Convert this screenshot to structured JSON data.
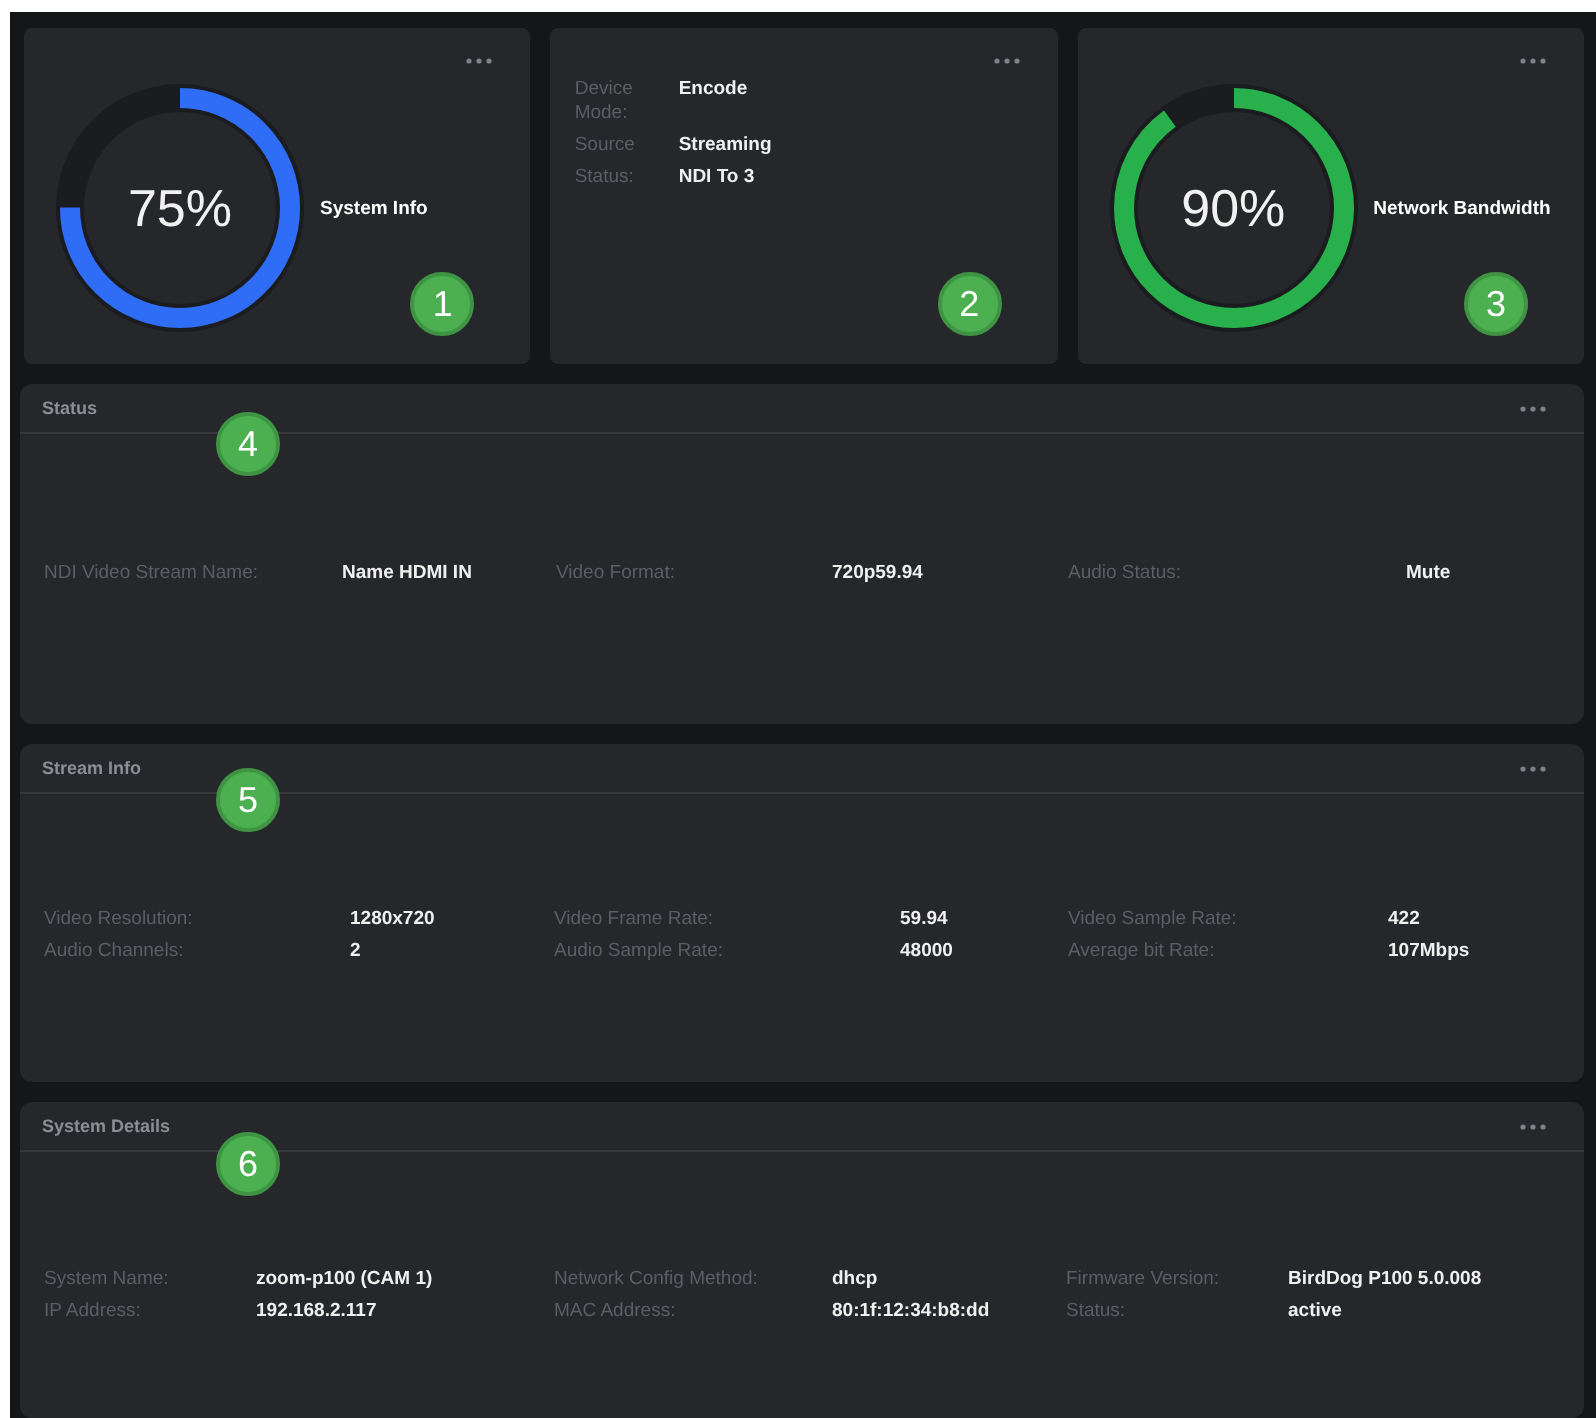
{
  "cards": [
    {
      "kind": "gauge",
      "reading": "75%",
      "level": 0.75,
      "color": "#2f6df6",
      "label": "System Info",
      "callout": "1"
    },
    {
      "kind": "details",
      "fields": [
        {
          "label": "Device Mode:",
          "value": "Encode"
        },
        {
          "label": "Source",
          "value": "Streaming"
        },
        {
          "label": "Status:",
          "value": "NDI To 3"
        }
      ],
      "callout": "2"
    },
    {
      "kind": "gauge",
      "reading": "90%",
      "level": 0.9,
      "color": "#27b04b",
      "label": "Network Bandwidth",
      "callout": "3"
    }
  ],
  "panels": [
    {
      "title": "Status",
      "callout": "4",
      "rows": [
        [
          {
            "label": "NDI Video Stream Name:",
            "value": "Name HDMI IN"
          },
          {
            "label": "Video Format:",
            "value": "720p59.94"
          },
          {
            "label": "Audio Status:",
            "value": "Mute"
          }
        ]
      ]
    },
    {
      "title": "Stream Info",
      "callout": "5",
      "rows": [
        [
          {
            "label": "Video Resolution:",
            "value": "1280x720"
          },
          {
            "label": "Video Frame Rate:",
            "value": "59.94"
          },
          {
            "label": "Video Sample Rate:",
            "value": "422"
          }
        ],
        [
          {
            "label": "Audio Channels:",
            "value": "2"
          },
          {
            "label": "Audio Sample Rate:",
            "value": "48000"
          },
          {
            "label": "Average bit Rate:",
            "value": "107Mbps"
          }
        ]
      ]
    },
    {
      "title": "System Details",
      "callout": "6",
      "rows": [
        [
          {
            "label": "System Name:",
            "value": "zoom-p100 (CAM 1)"
          },
          {
            "label": "Network Config Method:",
            "value": "dhcp"
          },
          {
            "label": "Firmware Version:",
            "value": "BirdDog P100 5.0.008"
          }
        ],
        [
          {
            "label": "IP Address:",
            "value": "192.168.2.117"
          },
          {
            "label": "MAC Address:",
            "value": "80:1f:12:34:b8:dd"
          },
          {
            "label": "Status:",
            "value": "active"
          }
        ]
      ]
    }
  ]
}
